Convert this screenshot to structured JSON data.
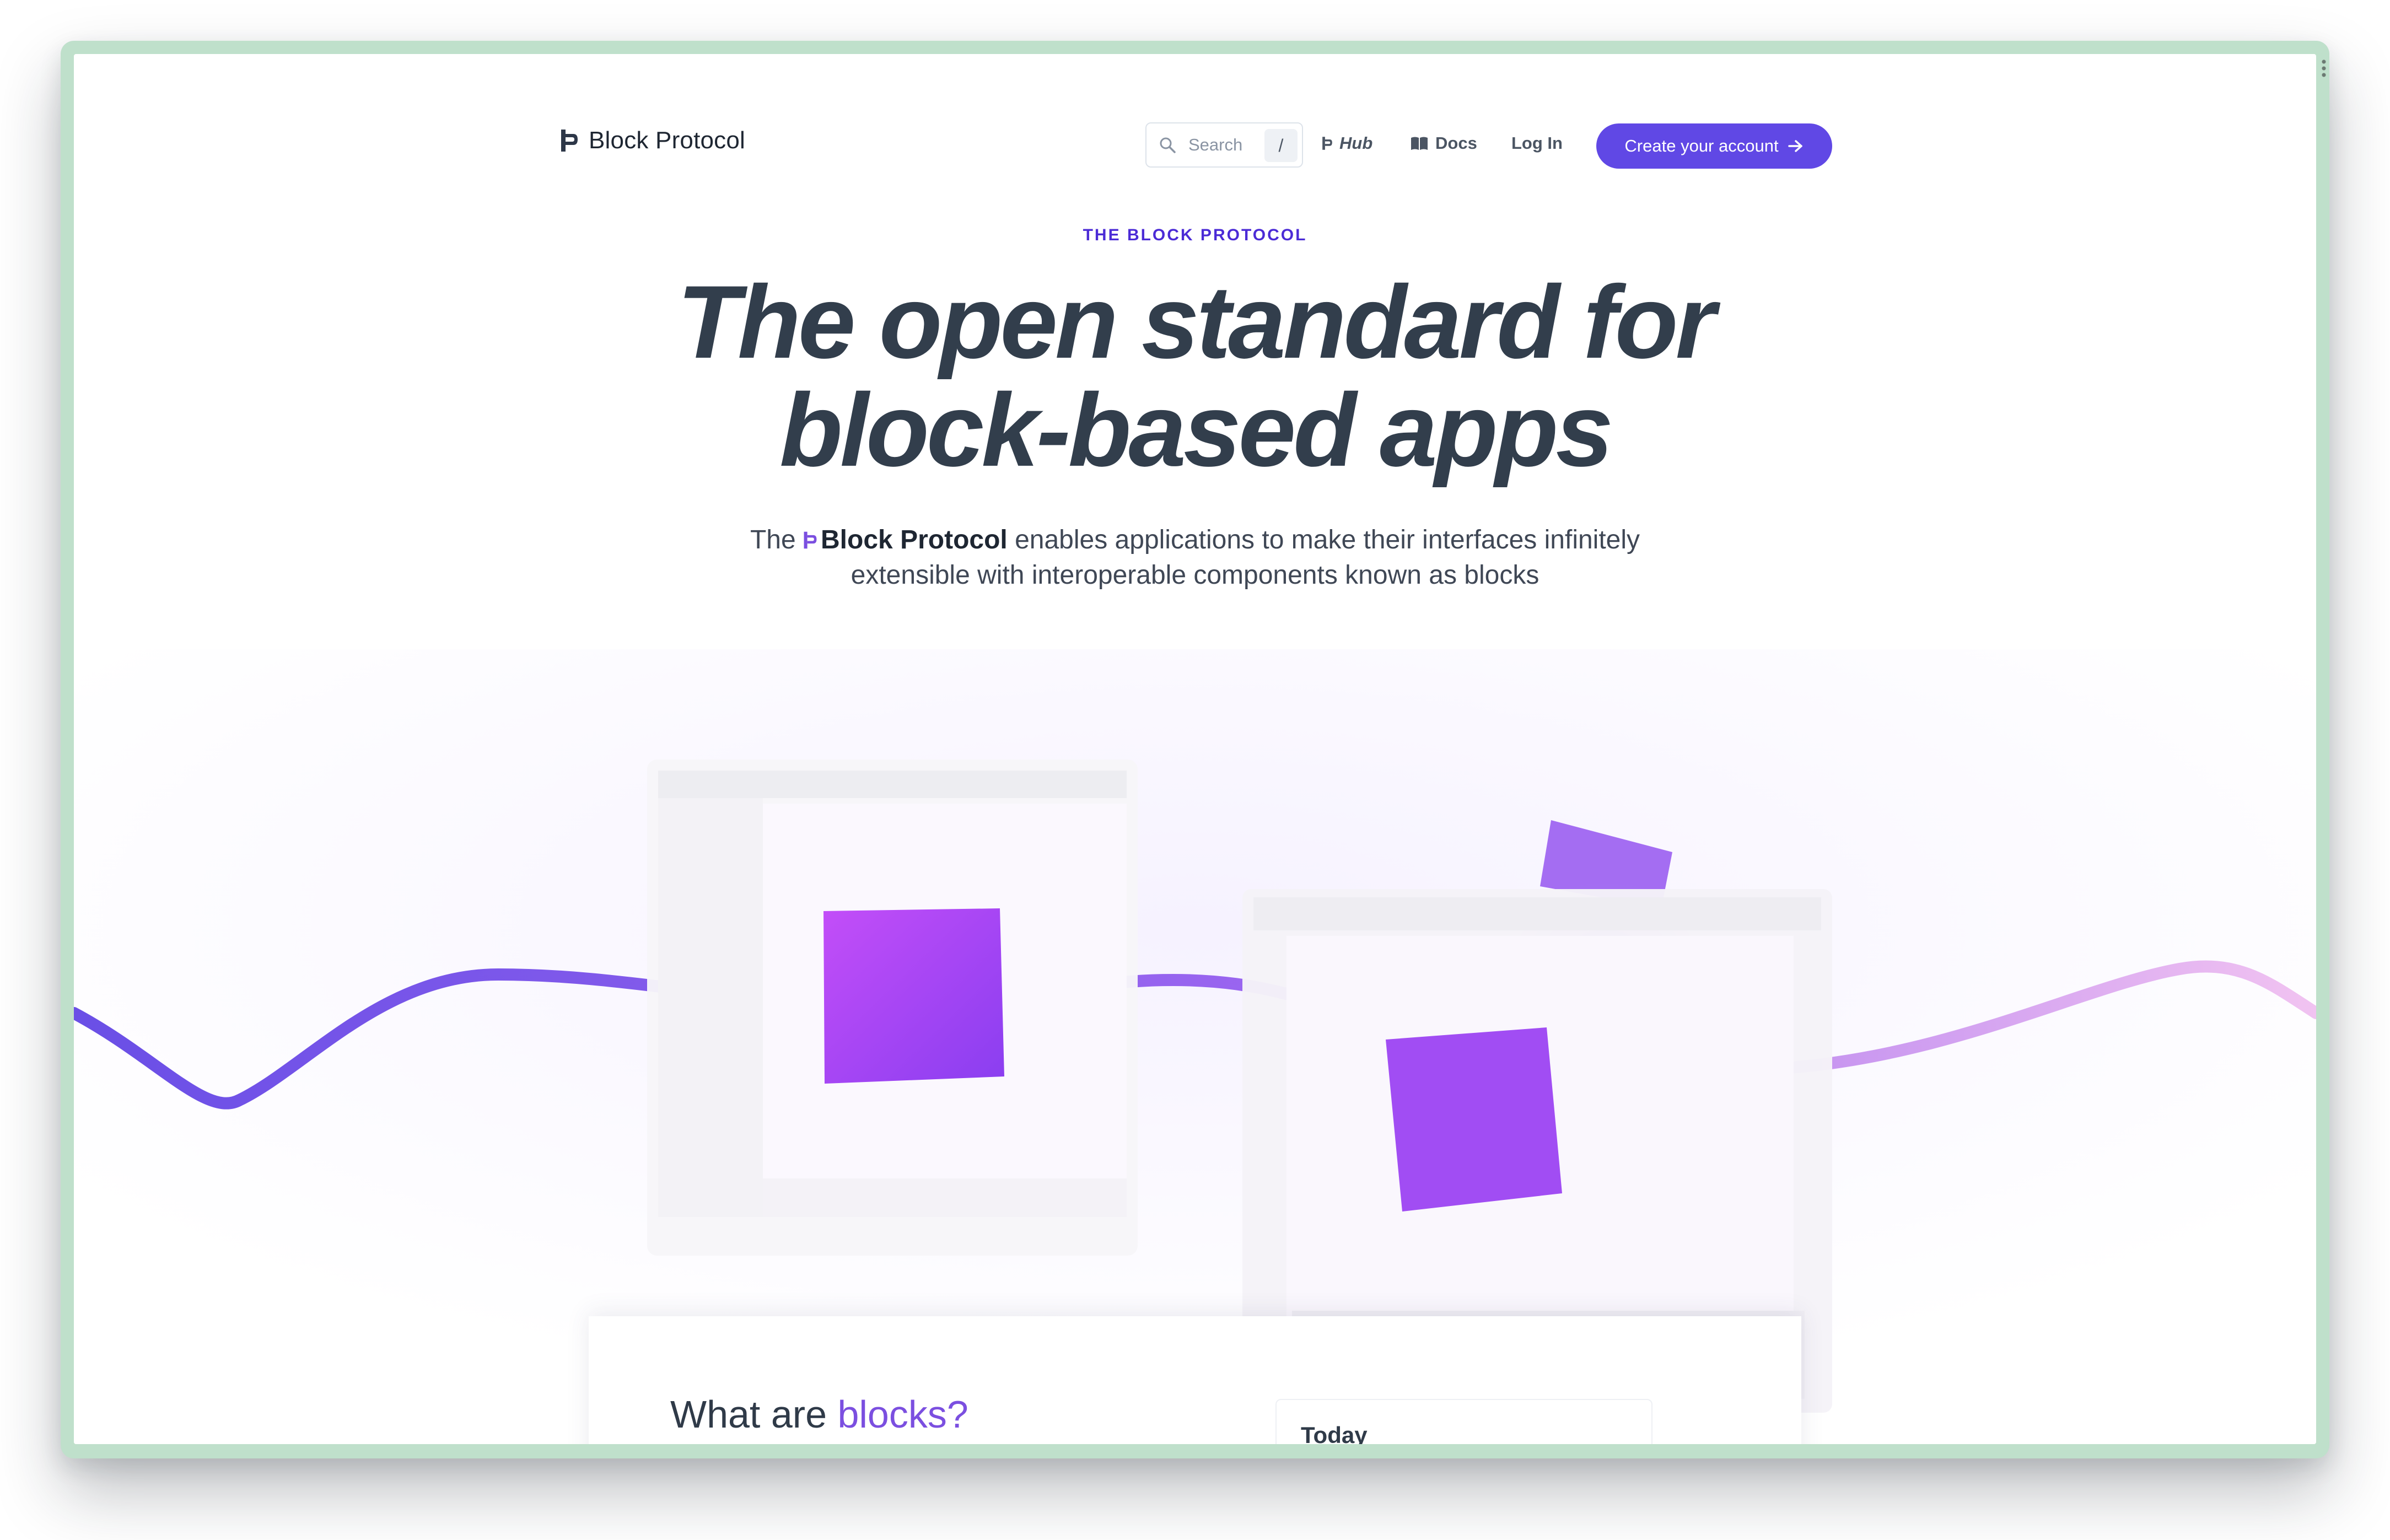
{
  "nav": {
    "brand": "Block Protocol",
    "search_placeholder": "Search",
    "search_shortcut": "/",
    "hub_label": "Hub",
    "docs_label": "Docs",
    "login_label": "Log In",
    "cta_label": "Create your account"
  },
  "hero": {
    "eyebrow": "THE BLOCK PROTOCOL",
    "headline_line1": "The open standard for",
    "headline_line2": "block-based apps",
    "subtitle_pre": "The",
    "subtitle_brand": "Block Protocol",
    "subtitle_post_line1": "enables applications to make their interfaces infinitely",
    "subtitle_line2": "extensible with interoperable components known as blocks"
  },
  "section": {
    "title_pre": "What are",
    "title_accent": "blocks?",
    "today_label": "Today"
  },
  "colors": {
    "primary": "#6048e5",
    "eyebrow": "#4b2bd6",
    "headline": "#323e4c",
    "cube": "#9d4cf5",
    "wave": "#7b5cf0",
    "frame": "#bfe0cb"
  },
  "icons": {
    "brand": "block-protocol-logo-icon",
    "search": "search-icon",
    "hub": "block-protocol-logo-icon",
    "docs": "book-icon",
    "cta": "arrow-right-icon"
  }
}
